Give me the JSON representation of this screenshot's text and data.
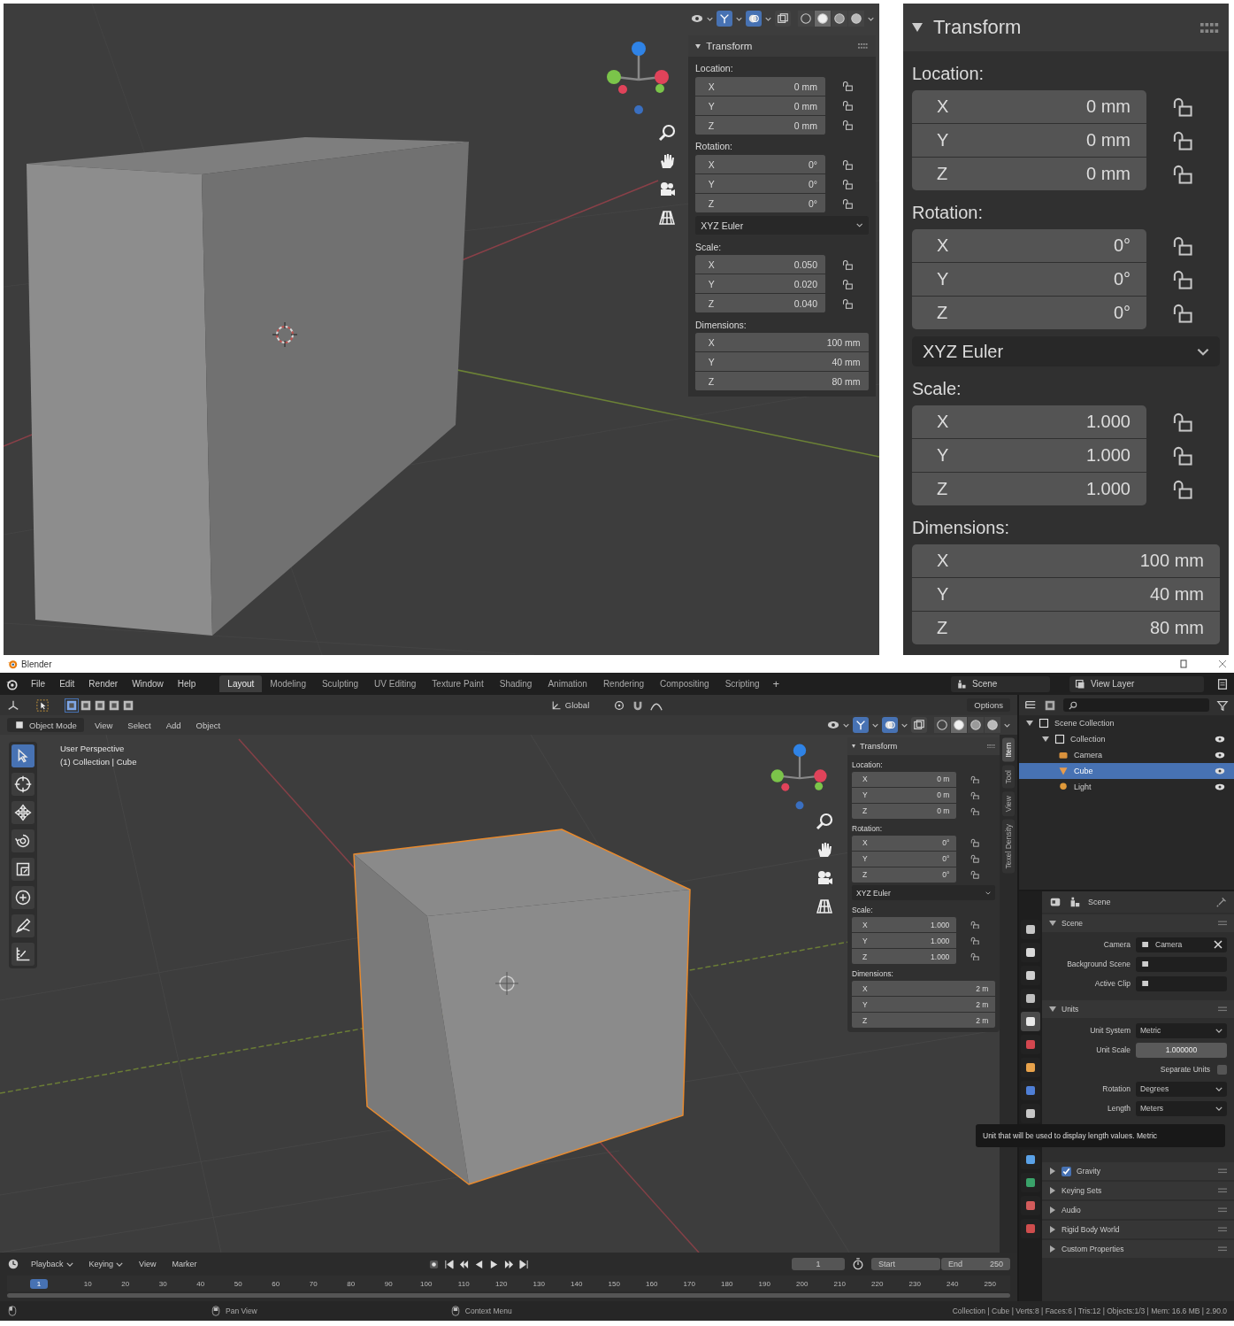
{
  "viewport_shot": {
    "header": {
      "gizmos": true,
      "overlays": true,
      "xray": false,
      "shading": [
        {
          "selected": false
        },
        {
          "selected": true
        },
        {
          "selected": false
        },
        {
          "selected": false
        }
      ]
    },
    "transform": {
      "title": "Transform",
      "sections": [
        {
          "kind": "vector",
          "label": "Location:",
          "lockable": true,
          "rows": [
            {
              "axis": "X",
              "value": "0 mm"
            },
            {
              "axis": "Y",
              "value": "0 mm"
            },
            {
              "axis": "Z",
              "value": "0 mm"
            }
          ]
        },
        {
          "kind": "vector",
          "label": "Rotation:",
          "lockable": true,
          "rows": [
            {
              "axis": "X",
              "value": "0°"
            },
            {
              "axis": "Y",
              "value": "0°"
            },
            {
              "axis": "Z",
              "value": "0°"
            }
          ]
        },
        {
          "kind": "dropdown",
          "value": "XYZ Euler"
        },
        {
          "kind": "vector",
          "label": "Scale:",
          "lockable": true,
          "rows": [
            {
              "axis": "X",
              "value": "0.050"
            },
            {
              "axis": "Y",
              "value": "0.020"
            },
            {
              "axis": "Z",
              "value": "0.040"
            }
          ]
        },
        {
          "kind": "vector",
          "label": "Dimensions:",
          "lockable": false,
          "rows": [
            {
              "axis": "X",
              "value": "100 mm"
            },
            {
              "axis": "Y",
              "value": "40 mm"
            },
            {
              "axis": "Z",
              "value": "80 mm"
            }
          ]
        }
      ]
    }
  },
  "transform_closeup": {
    "title": "Transform",
    "sections": [
      {
        "kind": "vector",
        "label": "Location:",
        "lockable": true,
        "rows": [
          {
            "axis": "X",
            "value": "0 mm"
          },
          {
            "axis": "Y",
            "value": "0 mm"
          },
          {
            "axis": "Z",
            "value": "0 mm"
          }
        ]
      },
      {
        "kind": "vector",
        "label": "Rotation:",
        "lockable": true,
        "rows": [
          {
            "axis": "X",
            "value": "0°"
          },
          {
            "axis": "Y",
            "value": "0°"
          },
          {
            "axis": "Z",
            "value": "0°"
          }
        ]
      },
      {
        "kind": "dropdown",
        "value": "XYZ Euler"
      },
      {
        "kind": "vector",
        "label": "Scale:",
        "lockable": true,
        "rows": [
          {
            "axis": "X",
            "value": "1.000"
          },
          {
            "axis": "Y",
            "value": "1.000"
          },
          {
            "axis": "Z",
            "value": "1.000"
          }
        ]
      },
      {
        "kind": "vector",
        "label": "Dimensions:",
        "lockable": false,
        "rows": [
          {
            "axis": "X",
            "value": "100 mm"
          },
          {
            "axis": "Y",
            "value": "40 mm"
          },
          {
            "axis": "Z",
            "value": "80 mm"
          }
        ]
      }
    ]
  },
  "blender_window": {
    "title": "Blender",
    "menu": [
      "File",
      "Edit",
      "Render",
      "Window",
      "Help"
    ],
    "workspaces": [
      {
        "label": "Layout",
        "selected": true
      },
      {
        "label": "Modeling",
        "selected": false
      },
      {
        "label": "Sculpting",
        "selected": false
      },
      {
        "label": "UV Editing",
        "selected": false
      },
      {
        "label": "Texture Paint",
        "selected": false
      },
      {
        "label": "Shading",
        "selected": false
      },
      {
        "label": "Animation",
        "selected": false
      },
      {
        "label": "Rendering",
        "selected": false
      },
      {
        "label": "Compositing",
        "selected": false
      },
      {
        "label": "Scripting",
        "selected": false
      }
    ],
    "add_workspace": "+",
    "scene": "Scene",
    "view_layer": "View Layer",
    "orientation": "Global",
    "options": "Options",
    "mode": "Object Mode",
    "viewport_menu": [
      "View",
      "Select",
      "Add",
      "Object"
    ],
    "overlay_text": [
      "User Perspective",
      "(1) Collection | Cube"
    ],
    "header": {
      "gizmos": true,
      "overlays": true,
      "xray": false,
      "shading": [
        {
          "selected": false
        },
        {
          "selected": true
        },
        {
          "selected": false
        },
        {
          "selected": false
        }
      ]
    },
    "tools": [
      {
        "selected": true
      },
      {
        "selected": false
      },
      {
        "selected": false
      },
      {
        "selected": false
      },
      {
        "selected": false
      },
      {
        "selected": false
      },
      {
        "selected": false
      },
      {
        "selected": false
      }
    ],
    "sidebar": {
      "tabs": [
        {
          "label": "Item",
          "selected": true
        },
        {
          "label": "Tool",
          "selected": false
        },
        {
          "label": "View",
          "selected": false
        },
        {
          "label": "Texel Density",
          "selected": false
        }
      ],
      "transform": {
        "title": "Transform",
        "sections": [
          {
            "kind": "vector",
            "label": "Location:",
            "lockable": true,
            "rows": [
              {
                "axis": "X",
                "value": "0 m"
              },
              {
                "axis": "Y",
                "value": "0 m"
              },
              {
                "axis": "Z",
                "value": "0 m"
              }
            ]
          },
          {
            "kind": "vector",
            "label": "Rotation:",
            "lockable": true,
            "rows": [
              {
                "axis": "X",
                "value": "0°"
              },
              {
                "axis": "Y",
                "value": "0°"
              },
              {
                "axis": "Z",
                "value": "0°"
              }
            ]
          },
          {
            "kind": "dropdown",
            "value": "XYZ Euler"
          },
          {
            "kind": "vector",
            "label": "Scale:",
            "lockable": true,
            "rows": [
              {
                "axis": "X",
                "value": "1.000"
              },
              {
                "axis": "Y",
                "value": "1.000"
              },
              {
                "axis": "Z",
                "value": "1.000"
              }
            ]
          },
          {
            "kind": "vector",
            "label": "Dimensions:",
            "lockable": false,
            "rows": [
              {
                "axis": "X",
                "value": "2 m"
              },
              {
                "axis": "Y",
                "value": "2 m"
              },
              {
                "axis": "Z",
                "value": "2 m"
              }
            ]
          }
        ]
      }
    },
    "outliner": {
      "items": [
        {
          "label": "Scene Collection",
          "kind": "collection",
          "selected": false,
          "children": [
            {
              "label": "Collection",
              "kind": "collection",
              "selected": false,
              "children": [
                {
                  "label": "Camera",
                  "kind": "camera",
                  "selected": false
                },
                {
                  "label": "Cube",
                  "kind": "mesh",
                  "selected": true
                },
                {
                  "label": "Light",
                  "kind": "light",
                  "selected": false
                }
              ]
            }
          ]
        }
      ]
    },
    "properties": {
      "header": "Scene",
      "tabs": [
        {
          "selected": false
        },
        {
          "selected": false
        },
        {
          "selected": false
        },
        {
          "selected": false
        },
        {
          "selected": true
        },
        {
          "selected": false
        },
        {
          "selected": false
        },
        {
          "selected": false
        },
        {
          "selected": false
        },
        {
          "selected": false
        },
        {
          "selected": false
        },
        {
          "selected": false
        },
        {
          "selected": false
        }
      ],
      "panels": [
        {
          "title": "Scene",
          "expanded": true,
          "fields": [
            {
              "label": "Camera",
              "kind": "object",
              "value": "Camera"
            },
            {
              "label": "Background Scene",
              "kind": "object"
            },
            {
              "label": "Active Clip",
              "kind": "object"
            }
          ]
        },
        {
          "title": "Units",
          "expanded": true,
          "fields": [
            {
              "label": "Unit System",
              "kind": "dropdown",
              "value": "Metric"
            },
            {
              "label": "Unit Scale",
              "kind": "number",
              "value": "1.000000"
            },
            {
              "label": "Separate Units",
              "kind": "checkbox",
              "checked": false
            },
            {
              "label": "Rotation",
              "kind": "dropdown",
              "value": "Degrees"
            },
            {
              "label": "Length",
              "kind": "dropdown",
              "value": "Meters"
            }
          ]
        },
        {
          "title": "Gravity",
          "expanded": false,
          "checked": true
        },
        {
          "title": "Keying Sets",
          "expanded": false
        },
        {
          "title": "Audio",
          "expanded": false
        },
        {
          "title": "Rigid Body World",
          "expanded": false
        },
        {
          "title": "Custom Properties",
          "expanded": false
        }
      ]
    },
    "tooltip": "Unit that will be used to display length values. Metric",
    "timeline": {
      "menu": [
        {
          "label": "Playback",
          "dropdown": true
        },
        {
          "label": "Keying",
          "dropdown": true
        },
        {
          "label": "View",
          "dropdown": false
        },
        {
          "label": "Marker",
          "dropdown": false
        }
      ],
      "frame": "1",
      "start_label": "Start",
      "end_label": "End",
      "end": "250",
      "current": "1",
      "ticks": [
        "10",
        "20",
        "30",
        "40",
        "50",
        "60",
        "70",
        "80",
        "90",
        "100",
        "110",
        "120",
        "130",
        "140",
        "150",
        "160",
        "170",
        "180",
        "190",
        "200",
        "210",
        "220",
        "230",
        "240",
        "250"
      ]
    },
    "status_bar": {
      "actions": [
        "Pan View",
        "Context Menu"
      ],
      "stats": "Collection | Cube | Verts:8 | Faces:6 | Tris:12 | Objects:1/3 | Mem: 16.6 MB | 2.90.0"
    }
  }
}
